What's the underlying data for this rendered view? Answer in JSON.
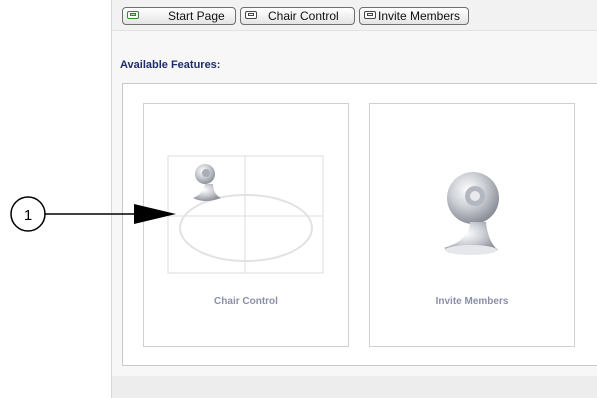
{
  "tabs": [
    {
      "label": "Start Page",
      "active": true
    },
    {
      "label": "Chair Control",
      "active": false
    },
    {
      "label": "Invite Members",
      "active": false
    }
  ],
  "section_title": "Available Features:",
  "features": [
    {
      "name": "Chair Control",
      "icon": "chair-control-webcam-grid-icon"
    },
    {
      "name": "Invite Members",
      "icon": "invite-members-webcam-icon"
    }
  ],
  "annotation": {
    "number": "1"
  },
  "colors": {
    "section_title": "#1e2d6b",
    "feature_label": "#8a90a8",
    "active_tab_icon": "#2e8b2e"
  }
}
